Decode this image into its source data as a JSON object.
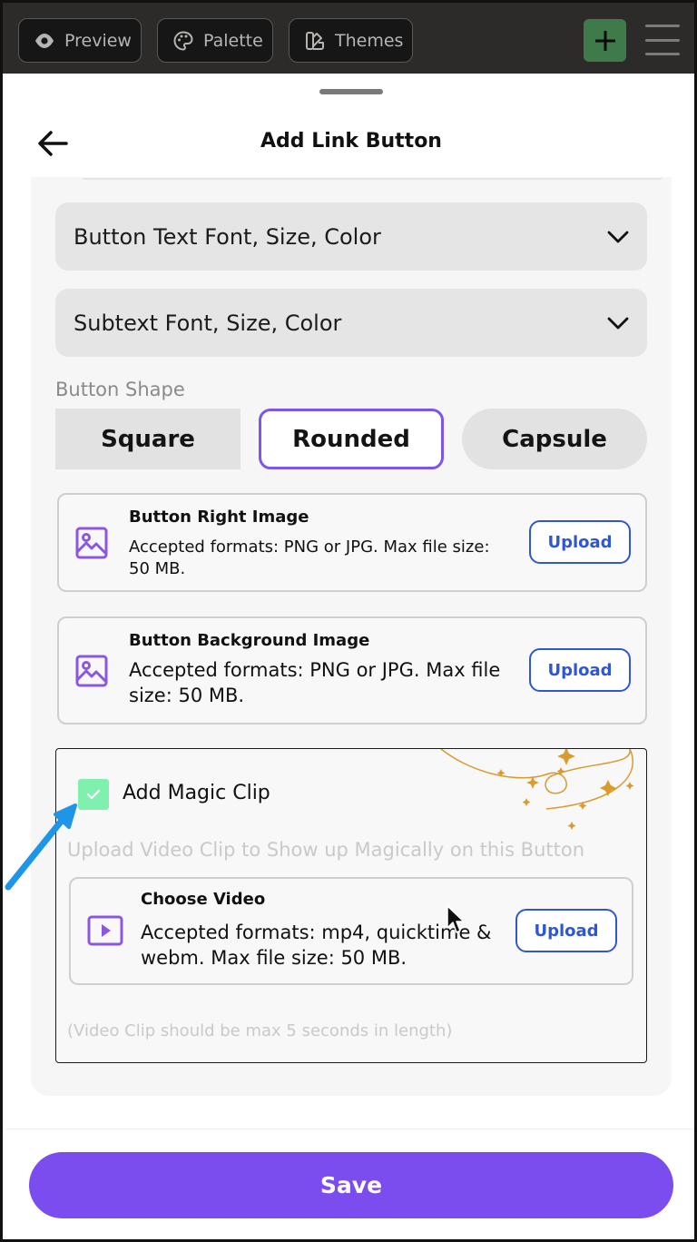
{
  "topbar": {
    "preview_label": "Preview",
    "palette_label": "Palette",
    "themes_label": "Themes",
    "plus_color": "#3f7a4b"
  },
  "sheet": {
    "title": "Add Link Button"
  },
  "accordions": [
    {
      "label": "Button Text Font, Size, Color"
    },
    {
      "label": "Subtext Font, Size, Color"
    }
  ],
  "button_shape": {
    "label": "Button Shape",
    "options": [
      "Square",
      "Rounded",
      "Capsule"
    ],
    "selected": "Rounded"
  },
  "right_image": {
    "title": "Button Right Image",
    "description": "Accepted formats: PNG or JPG. Max file size: 50 MB.",
    "upload_label": "Upload"
  },
  "background_image": {
    "title": "Button Background Image",
    "description": "Accepted formats: PNG or JPG. Max file size: 50 MB.",
    "upload_label": "Upload"
  },
  "magic_clip": {
    "checkbox_label": "Add Magic Clip",
    "checked": true,
    "subtitle": "Upload Video Clip to Show up Magically on this Button",
    "video_title": "Choose Video",
    "video_description": "Accepted formats: mp4, quicktime & webm. Max file size: 50 MB.",
    "upload_label": "Upload",
    "note": "(Video Clip should be max 5 seconds in length)"
  },
  "save_label": "Save",
  "colors": {
    "accent": "#7c4dee",
    "upload_blue": "#2e57d4",
    "checkbox_green": "#7ff0ae"
  }
}
